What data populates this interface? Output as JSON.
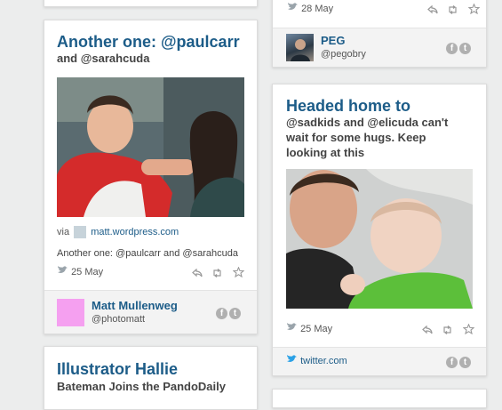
{
  "top_left_card": {},
  "card_top_right": {
    "date": "28 May",
    "user_name": "PEG",
    "user_handle": "@pegobry",
    "icons": [
      "reply-icon",
      "retweet-icon",
      "favorite-icon"
    ]
  },
  "card_paulcarr": {
    "title": "Another one: @paulcarr",
    "subtitle": "and @sarahcuda",
    "via_label": "via",
    "via_link": "matt.wordpress.com",
    "caption": "Another one: @paulcarr and @sarahcuda",
    "date": "25 May",
    "user_name": "Matt Mullenweg",
    "user_handle": "@photomatt"
  },
  "card_headed_home": {
    "title": "Headed home to",
    "subtitle": "@sadkids and @elicuda can't wait for some hugs. Keep looking at this",
    "date": "25 May",
    "source_link": "twitter.com"
  },
  "card_illustrator": {
    "title": "Illustrator Hallie",
    "subtitle": "Bateman Joins the PandoDaily"
  },
  "colors": {
    "title_blue": "#1c5c88",
    "avatar_pink": "#f5a0f0"
  }
}
